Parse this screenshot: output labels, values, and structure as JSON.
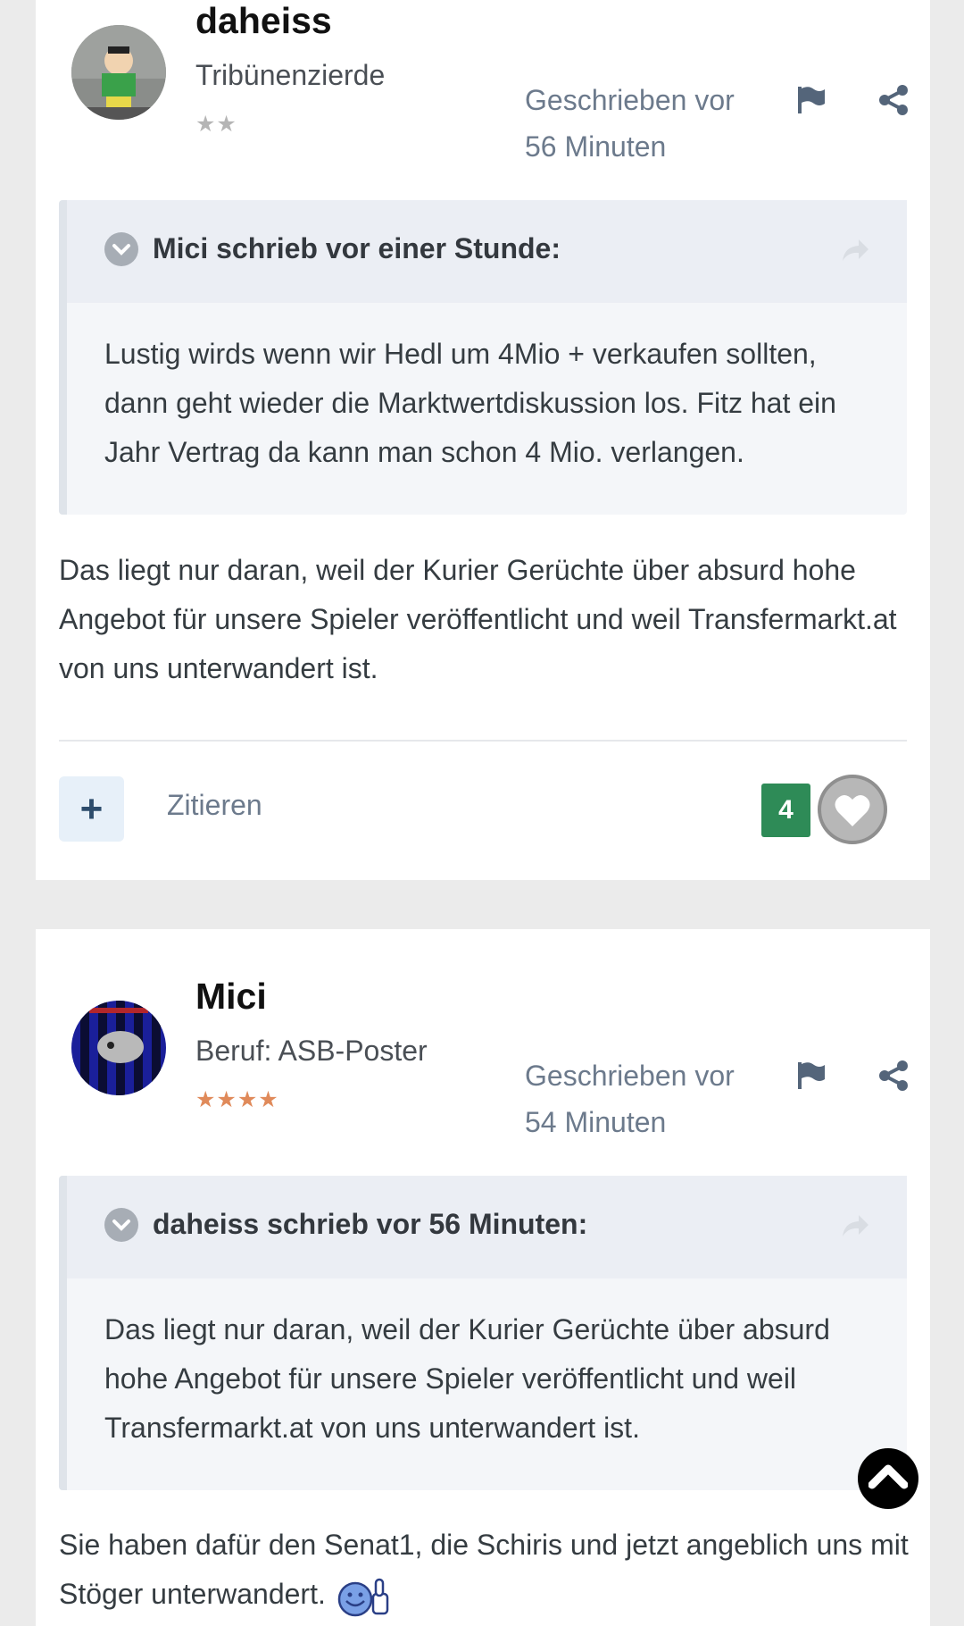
{
  "posts": [
    {
      "author": "daheiss",
      "rank": "Tribünenzierde",
      "stars": "★★",
      "time": "Geschrieben vor 56 Minuten",
      "quote": {
        "title": "Mici schrieb vor einer Stunde:",
        "text": "Lustig wirds wenn wir Hedl um 4Mio + verkaufen sollten, dann geht wieder die Marktwertdiskussion los. Fitz hat ein Jahr Vertrag da kann man schon 4 Mio. verlangen."
      },
      "text": "Das liegt nur daran, weil der Kurier Gerüchte über absurd hohe Angebot für unsere Spieler veröffentlicht und weil Transfermarkt.at von uns unterwandert ist.",
      "plus_label": "+",
      "quote_action": "Zitieren",
      "like_count": "4"
    },
    {
      "author": "Mici",
      "rank": "Beruf: ASB-Poster",
      "stars": "★★★★",
      "time": "Geschrieben vor 54 Minuten",
      "quote": {
        "title": "daheiss schrieb vor 56 Minuten:",
        "text": "Das liegt nur daran, weil der Kurier Gerüchte über absurd hohe Angebot für unsere Spieler veröffentlicht und weil Transfermarkt.at von uns unterwandert ist."
      },
      "text": "Sie haben dafür den Senat1, die Schiris und jetzt angeblich uns mit Stöger unterwandert."
    }
  ],
  "icons": {
    "report": "flag-icon",
    "share": "share-icon",
    "quote_toggle": "chevron-down-icon",
    "quote_jump": "share-arrow-icon",
    "like": "heart-icon",
    "scroll_top": "chevron-up-icon",
    "emoji": "thumbs-up-smiley-icon"
  },
  "colors": {
    "like_count_bg": "#2e8b57",
    "meta_text": "#6c7a8c",
    "quote_bg": "#f4f6f9"
  }
}
